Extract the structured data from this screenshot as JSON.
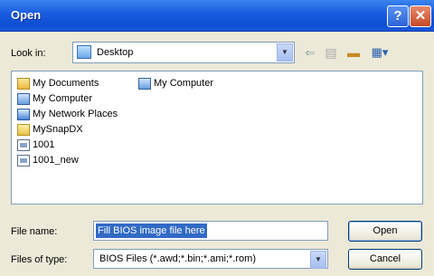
{
  "window": {
    "title": "Open"
  },
  "titlebar": {
    "help_glyph": "?",
    "close_glyph": "✕"
  },
  "look_in": {
    "label": "Look in:",
    "value": "Desktop"
  },
  "toolbar": {
    "back_glyph": "⇐",
    "up_glyph": "▤",
    "new_folder_glyph": "▬",
    "views_glyph": "▦▾"
  },
  "files": [
    {
      "label": "My Documents",
      "icon": "my-documents-icon"
    },
    {
      "label": "My Computer",
      "icon": "my-computer-icon"
    },
    {
      "label": "My Network Places",
      "icon": "network-places-icon"
    },
    {
      "label": "MySnapDX",
      "icon": "folder-icon"
    },
    {
      "label": "1001",
      "icon": "file-icon"
    },
    {
      "label": "1001_new",
      "icon": "file-icon"
    },
    {
      "label": "My Computer",
      "icon": "my-computer-icon"
    }
  ],
  "file_name": {
    "label": "File name:",
    "value": "Fill BIOS image file here"
  },
  "files_of_type": {
    "label": "Files of type:",
    "value": "BIOS Files (*.awd;*.bin;*.ami;*.rom)"
  },
  "buttons": {
    "open": "Open",
    "cancel": "Cancel"
  },
  "colors": {
    "titlebar": "#1c5ee1",
    "selection": "#316ac5",
    "dialog_bg": "#ece9d8"
  }
}
